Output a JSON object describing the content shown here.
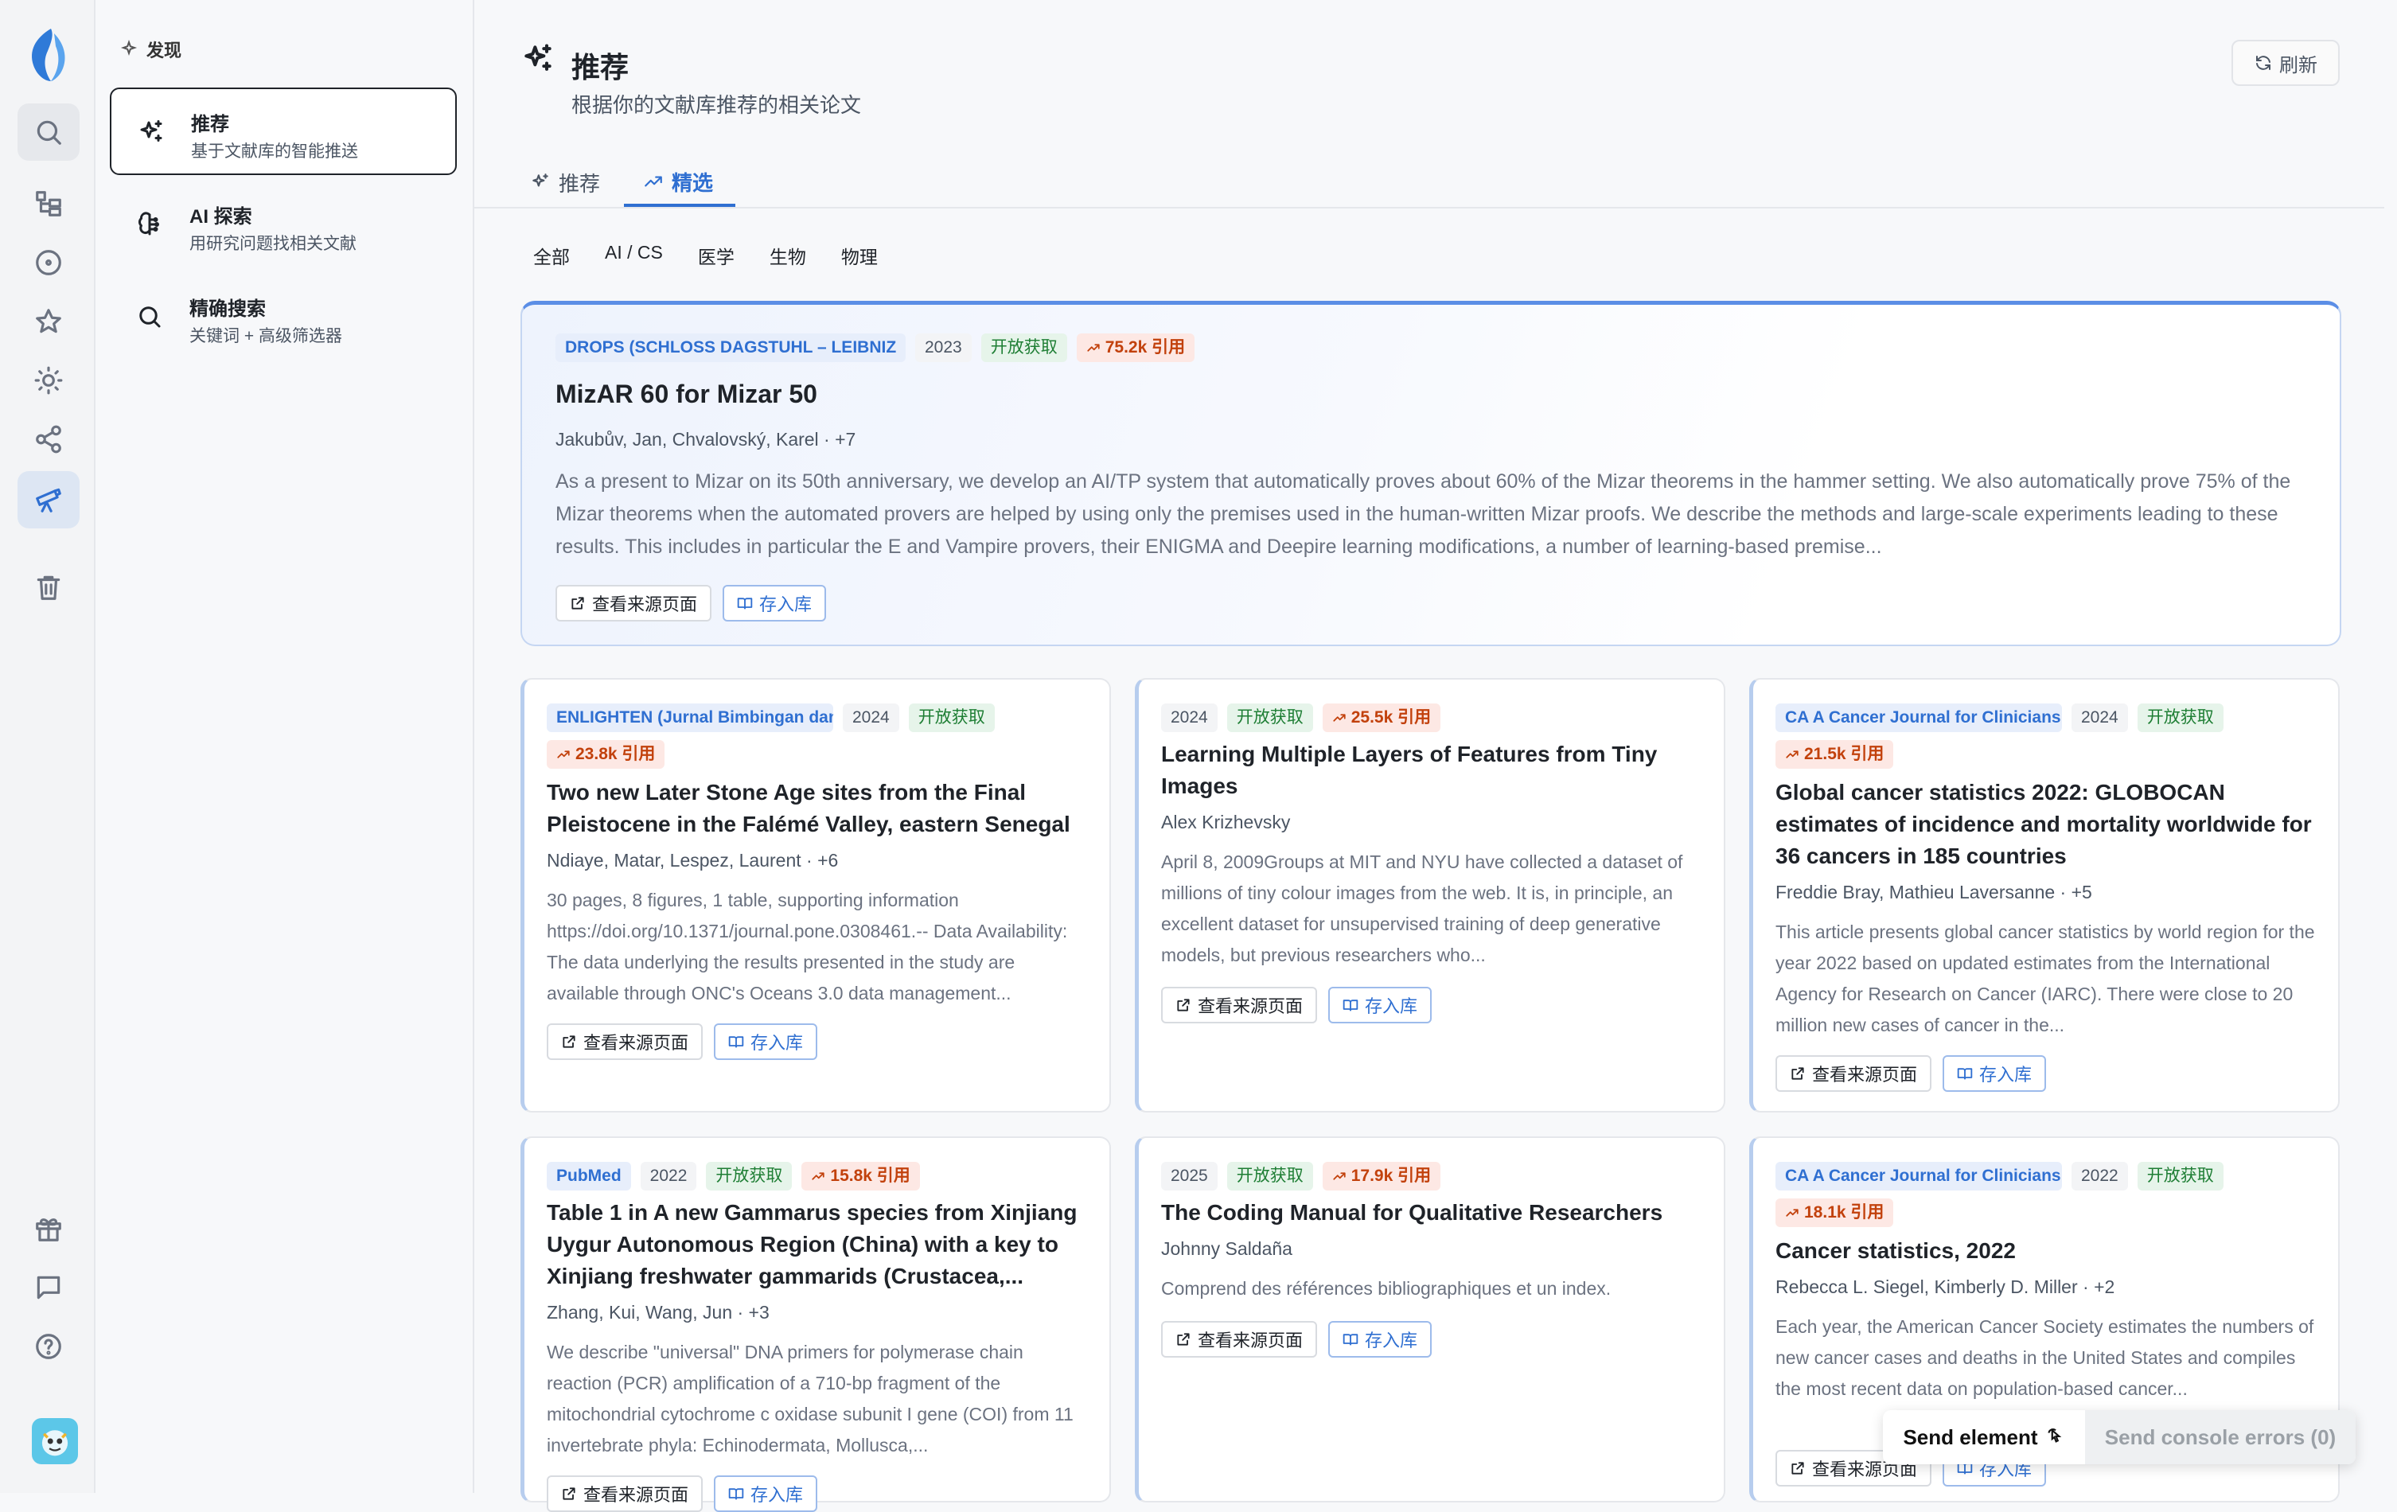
{
  "sidebar": {
    "section_title": "发现",
    "items": [
      {
        "title": "推荐",
        "desc": "基于文献库的智能推送"
      },
      {
        "title": "AI 探索",
        "desc": "用研究问题找相关文献"
      },
      {
        "title": "精确搜索",
        "desc": "关键词 + 高级筛选器"
      }
    ]
  },
  "header": {
    "title": "推荐",
    "subtitle": "根据你的文献库推荐的相关论文",
    "refresh_label": "刷新"
  },
  "tabs": [
    {
      "label": "推荐",
      "active": false
    },
    {
      "label": "精选",
      "active": true
    }
  ],
  "filters": [
    "全部",
    "AI / CS",
    "医学",
    "生物",
    "物理"
  ],
  "actions": {
    "source_label": "查看来源页面",
    "save_label": "存入库"
  },
  "featured": {
    "venue": "DROPS (SCHLOSS DAGSTUHL – LEIBNIZ",
    "year": "2023",
    "oa": "开放获取",
    "citations": "75.2k 引用",
    "title": "MizAR 60 for Mizar 50",
    "authors": "Jakubův, Jan, Chvalovský, Karel · +7",
    "abstract": "As a present to Mizar on its 50th anniversary, we develop an AI/TP system that automatically proves about 60% of the Mizar theorems in the hammer setting. We also automatically prove 75% of the Mizar theorems when the automated provers are helped by using only the premises used in the human-written Mizar proofs. We describe the methods and large-scale experiments leading to these results. This includes in particular the E and Vampire provers, their ENIGMA and Deepire learning modifications, a number of learning-based premise..."
  },
  "papers": [
    {
      "venue": "ENLIGHTEN (Jurnal Bimbingan dan",
      "year": "2024",
      "oa": "开放获取",
      "citations": "23.8k 引用",
      "title": "Two new Later Stone Age sites from the Final Pleistocene in the Falémé Valley, eastern Senegal",
      "authors": "Ndiaye, Matar, Lespez, Laurent · +6",
      "abstract": "30 pages, 8 figures, 1 table, supporting information https://doi.org/10.1371/journal.pone.0308461.-- Data Availability: The data underlying the results presented in the study are available through ONC's Oceans 3.0 data management..."
    },
    {
      "venue": "",
      "year": "2024",
      "oa": "开放获取",
      "citations": "25.5k 引用",
      "title": "Learning Multiple Layers of Features from Tiny Images",
      "authors": "Alex Krizhevsky",
      "abstract": "April 8, 2009Groups at MIT and NYU have collected a dataset of millions of tiny colour images from the web. It is, in principle, an excellent dataset for unsupervised training of deep generative models, but previous researchers who..."
    },
    {
      "venue": "CA A Cancer Journal for Clinicians",
      "year": "2024",
      "oa": "开放获取",
      "citations": "21.5k 引用",
      "title": "Global cancer statistics 2022: GLOBOCAN estimates of incidence and mortality worldwide for 36 cancers in 185 countries",
      "authors": "Freddie Bray, Mathieu Laversanne · +5",
      "abstract": "This article presents global cancer statistics by world region for the year 2022 based on updated estimates from the International Agency for Research on Cancer (IARC). There were close to 20 million new cases of cancer in the..."
    },
    {
      "venue": "PubMed",
      "year": "2022",
      "oa": "开放获取",
      "citations": "15.8k 引用",
      "title": "Table 1 in A new Gammarus species from Xinjiang Uygur Autonomous Region (China) with a key to Xinjiang freshwater gammarids (Crustacea,...",
      "authors": "Zhang, Kui, Wang, Jun · +3",
      "abstract": "We describe \"universal\" DNA primers for polymerase chain reaction (PCR) amplification of a 710-bp fragment of the mitochondrial cytochrome c oxidase subunit I gene (COI) from 11 invertebrate phyla: Echinodermata, Mollusca,..."
    },
    {
      "venue": "",
      "year": "2025",
      "oa": "开放获取",
      "citations": "17.9k 引用",
      "title": "The Coding Manual for Qualitative Researchers",
      "authors": "Johnny Saldaña",
      "abstract": "Comprend des références bibliographiques et un index."
    },
    {
      "venue": "CA A Cancer Journal for Clinicians",
      "year": "2022",
      "oa": "开放获取",
      "citations": "18.1k 引用",
      "title": "Cancer statistics, 2022",
      "authors": "Rebecca L. Siegel, Kimberly D. Miller · +2",
      "abstract": "Each year, the American Cancer Society estimates the numbers of new cancer cases and deaths in the United States and compiles the most recent data on population-based cancer..."
    }
  ],
  "dev_overlay": {
    "send_element": "Send element",
    "send_errors": "Send console errors (0)"
  },
  "colors": {
    "accent": "#2f6fd1",
    "open_access": "#1e7e34",
    "citations": "#c2410c"
  }
}
